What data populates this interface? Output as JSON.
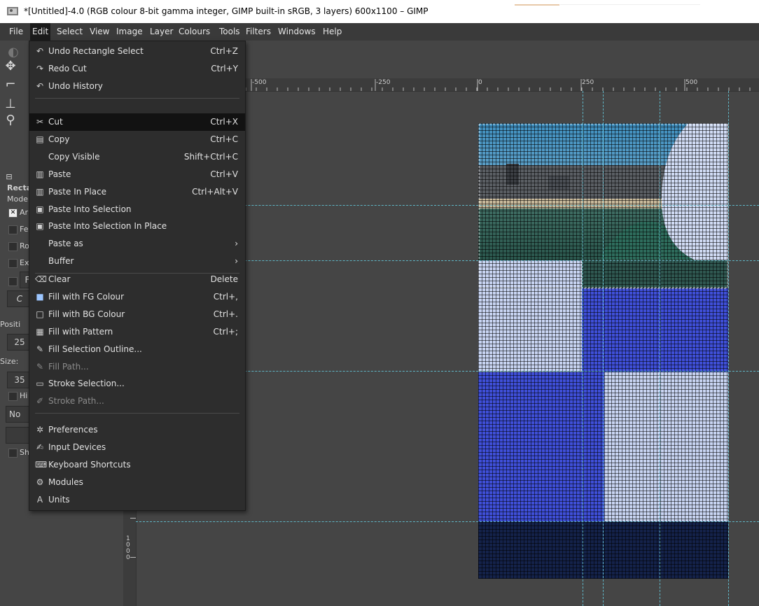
{
  "window": {
    "title": "*[Untitled]-4.0 (RGB colour 8-bit gamma integer, GIMP built-in sRGB, 3 layers) 600x1100 – GIMP",
    "app_icon": "gimp-icon"
  },
  "menubar": {
    "items": [
      "File",
      "Edit",
      "Select",
      "View",
      "Image",
      "Layer",
      "Colours",
      "Tools",
      "Filters",
      "Windows",
      "Help"
    ],
    "active": "Edit"
  },
  "edit_menu": {
    "groups": [
      [
        {
          "label": "Undo Rectangle Select",
          "shortcut": "Ctrl+Z",
          "icon": "undo-icon"
        },
        {
          "label": "Redo Cut",
          "shortcut": "Ctrl+Y",
          "icon": "redo-icon"
        },
        {
          "label": "Undo History",
          "shortcut": "",
          "icon": "undo-history-icon"
        }
      ],
      [
        {
          "label": "Cut",
          "shortcut": "Ctrl+X",
          "icon": "scissors-icon",
          "highlighted": true
        },
        {
          "label": "Copy",
          "shortcut": "Ctrl+C",
          "icon": "copy-icon"
        },
        {
          "label": "Copy Visible",
          "shortcut": "Shift+Ctrl+C",
          "icon": ""
        },
        {
          "label": "Paste",
          "shortcut": "Ctrl+V",
          "icon": "paste-icon"
        },
        {
          "label": "Paste In Place",
          "shortcut": "Ctrl+Alt+V",
          "icon": "paste-in-place-icon"
        },
        {
          "label": "Paste Into Selection",
          "shortcut": "",
          "icon": "paste-into-selection-icon"
        },
        {
          "label": "Paste Into Selection In Place",
          "shortcut": "",
          "icon": "paste-into-selection-in-place-icon"
        },
        {
          "label": "Paste as",
          "shortcut": "›",
          "icon": ""
        },
        {
          "label": "Buffer",
          "shortcut": "›",
          "icon": ""
        }
      ],
      [
        {
          "label": "Clear",
          "shortcut": "Delete",
          "icon": "clear-icon"
        },
        {
          "label": "Fill with FG Colour",
          "shortcut": "Ctrl+,",
          "icon": "fill-fg-icon"
        },
        {
          "label": "Fill with BG Colour",
          "shortcut": "Ctrl+.",
          "icon": "fill-bg-icon"
        },
        {
          "label": "Fill with Pattern",
          "shortcut": "Ctrl+;",
          "icon": "fill-pattern-icon"
        },
        {
          "label": "Fill Selection Outline...",
          "shortcut": "",
          "icon": "fill-outline-icon"
        },
        {
          "label": "Fill Path...",
          "shortcut": "",
          "icon": "fill-path-icon",
          "disabled": true
        },
        {
          "label": "Stroke Selection...",
          "shortcut": "",
          "icon": "stroke-selection-icon"
        },
        {
          "label": "Stroke Path...",
          "shortcut": "",
          "icon": "stroke-path-icon",
          "disabled": true
        }
      ],
      [
        {
          "label": "Preferences",
          "shortcut": "",
          "icon": "preferences-icon"
        },
        {
          "label": "Input Devices",
          "shortcut": "",
          "icon": "input-devices-icon"
        },
        {
          "label": "Keyboard Shortcuts",
          "shortcut": "",
          "icon": "keyboard-icon"
        },
        {
          "label": "Modules",
          "shortcut": "",
          "icon": "modules-icon"
        },
        {
          "label": "Units",
          "shortcut": "",
          "icon": "units-icon"
        }
      ]
    ]
  },
  "tool_options": {
    "title_fragment": "Recta",
    "mode_fragment": "Mode",
    "checkbox_fragments": [
      "Ar",
      "Fe",
      "Ro",
      "Ex",
      "F",
      "Hi",
      "Sh"
    ],
    "position_label": "Positi",
    "position_value": "25",
    "size_label": "Size:",
    "size_value": "35",
    "highlight_dropdown": "No",
    "shape_fragment": "C"
  },
  "rulers": {
    "horizontal_labels": [
      "-500",
      "-250",
      "0",
      "250",
      "500"
    ],
    "vertical_label": "1000"
  },
  "colors": {
    "menu_bg": "#2d2d2d",
    "menu_highlight": "#121212",
    "canvas_bg": "#454545",
    "guide": "#5fb5c5",
    "blue_fill": "#3f4fd8",
    "light_fill": "#c8d4f2",
    "dark_fill": "#14224a"
  }
}
